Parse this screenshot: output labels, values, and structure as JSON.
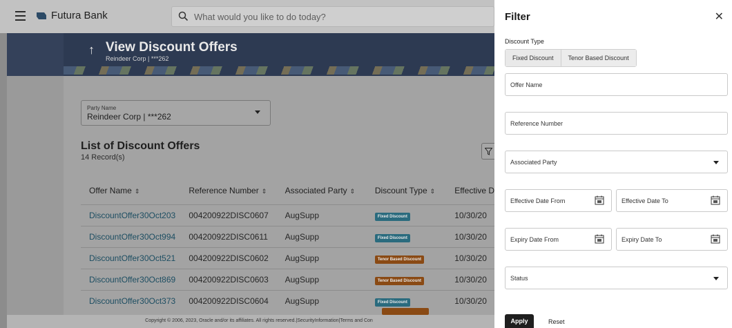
{
  "header": {
    "brand": "Futura Bank",
    "search_placeholder": "What would you like to do today?"
  },
  "page": {
    "title": "View Discount Offers",
    "subtitle": "Reindeer Corp | ***262"
  },
  "party": {
    "label": "Party Name",
    "value": "Reindeer Corp | ***262"
  },
  "list": {
    "title": "List of Discount Offers",
    "records": "14 Record(s)",
    "columns": [
      "Offer Name",
      "Reference Number",
      "Associated Party",
      "Discount Type",
      "Effective D"
    ],
    "rows": [
      {
        "name": "DiscountOffer30Oct203",
        "ref": "004200922DISC0607",
        "party": "AugSupp",
        "type": "Fixed Discount",
        "kind": "fixed",
        "date": "10/30/20"
      },
      {
        "name": "DiscountOffer30Oct994",
        "ref": "004200922DISC0611",
        "party": "AugSupp",
        "type": "Fixed Discount",
        "kind": "fixed",
        "date": "10/30/20"
      },
      {
        "name": "DiscountOffer30Oct521",
        "ref": "004200922DISC0602",
        "party": "AugSupp",
        "type": "Tenor Based Discount",
        "kind": "tenor",
        "date": "10/30/20"
      },
      {
        "name": "DiscountOffer30Oct869",
        "ref": "004200922DISC0603",
        "party": "AugSupp",
        "type": "Tenor Based Discount",
        "kind": "tenor",
        "date": "10/30/20"
      },
      {
        "name": "DiscountOffer30Oct373",
        "ref": "004200922DISC0604",
        "party": "AugSupp",
        "type": "Fixed Discount",
        "kind": "fixed",
        "date": "10/30/20"
      }
    ]
  },
  "footer": {
    "text": "Copyright © 2006, 2023, Oracle and/or its affiliates. All rights reserved.|SecurityInformation|Terms and Con"
  },
  "filter": {
    "title": "Filter",
    "discount_type_label": "Discount Type",
    "segments": [
      "Fixed Discount",
      "Tenor Based Discount"
    ],
    "offer_name": "Offer Name",
    "reference_number": "Reference Number",
    "associated_party": "Associated Party",
    "effective_from": "Effective Date From",
    "effective_to": "Effective Date To",
    "expiry_from": "Expiry Date From",
    "expiry_to": "Expiry Date To",
    "status": "Status",
    "apply": "Apply",
    "reset": "Reset"
  },
  "colors": {
    "banner": "#34415a",
    "fixed_badge": "#2a6b7e",
    "tenor_badge": "#8a4a14",
    "link": "#1d4e62"
  }
}
